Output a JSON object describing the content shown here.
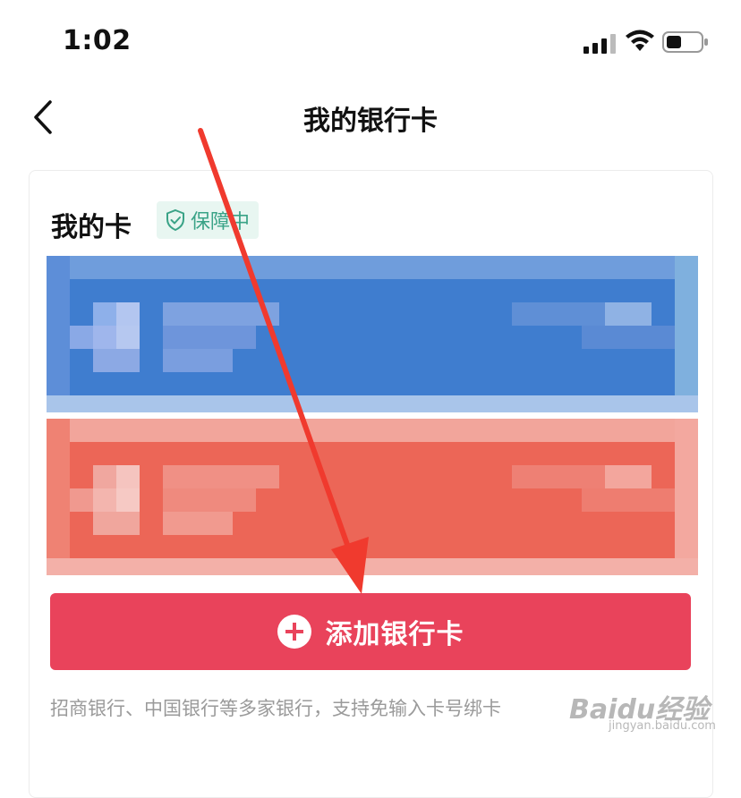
{
  "status_bar": {
    "time": "1:02"
  },
  "header": {
    "title": "我的银行卡"
  },
  "section": {
    "title": "我的卡",
    "badge_label": "保障中"
  },
  "cards": [
    {
      "style": "pixelated",
      "color": "#3f7dcf"
    },
    {
      "style": "pixelated",
      "color": "#ec6657"
    }
  ],
  "add_card_button": {
    "label": "添加银行卡"
  },
  "hint": "招商银行、中国银行等多家银行，支持免输入卡号绑卡",
  "watermark": {
    "main": "Baidu经验",
    "sub": "jingyan.baidu.com"
  },
  "colors": {
    "accent": "#e9435b",
    "badge_green": "#3aa387",
    "arrow": "#f03a2e"
  }
}
